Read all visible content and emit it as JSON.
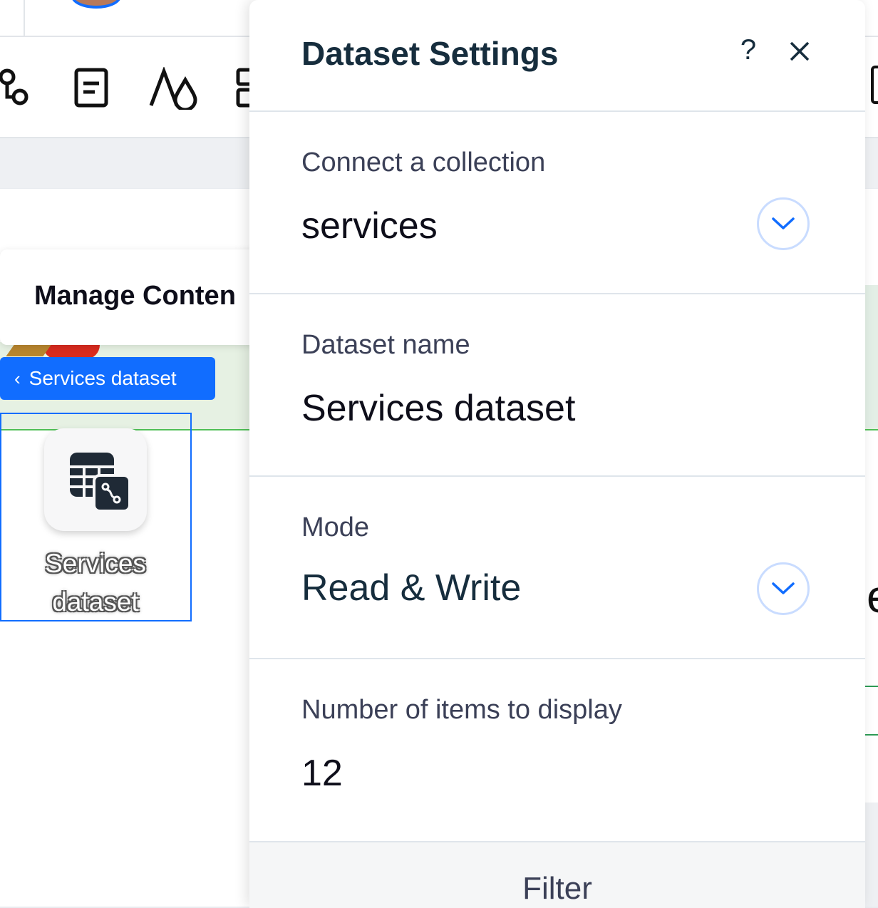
{
  "panel": {
    "title": "Dataset Settings",
    "help_label": "?",
    "close_icon": "close-icon"
  },
  "collection": {
    "label": "Connect a collection",
    "value": "services"
  },
  "dataset_name": {
    "label": "Dataset name",
    "value": "Services dataset"
  },
  "mode": {
    "label": "Mode",
    "value": "Read & Write"
  },
  "items": {
    "label": "Number of items to display",
    "value": "12"
  },
  "filter": {
    "label": "Filter"
  },
  "editor": {
    "manage_title": "Manage Conten",
    "breadcrumb": "Services dataset",
    "breadcrumb_chevron": "‹",
    "element_label_line1": "Services",
    "element_label_line2": "dataset",
    "right_edge_glyph": "e"
  },
  "colors": {
    "accent": "#116dff",
    "title_text": "#162d3d",
    "dropdown_ring": "#c9dcff",
    "dropdown_chevron": "#116dff"
  }
}
